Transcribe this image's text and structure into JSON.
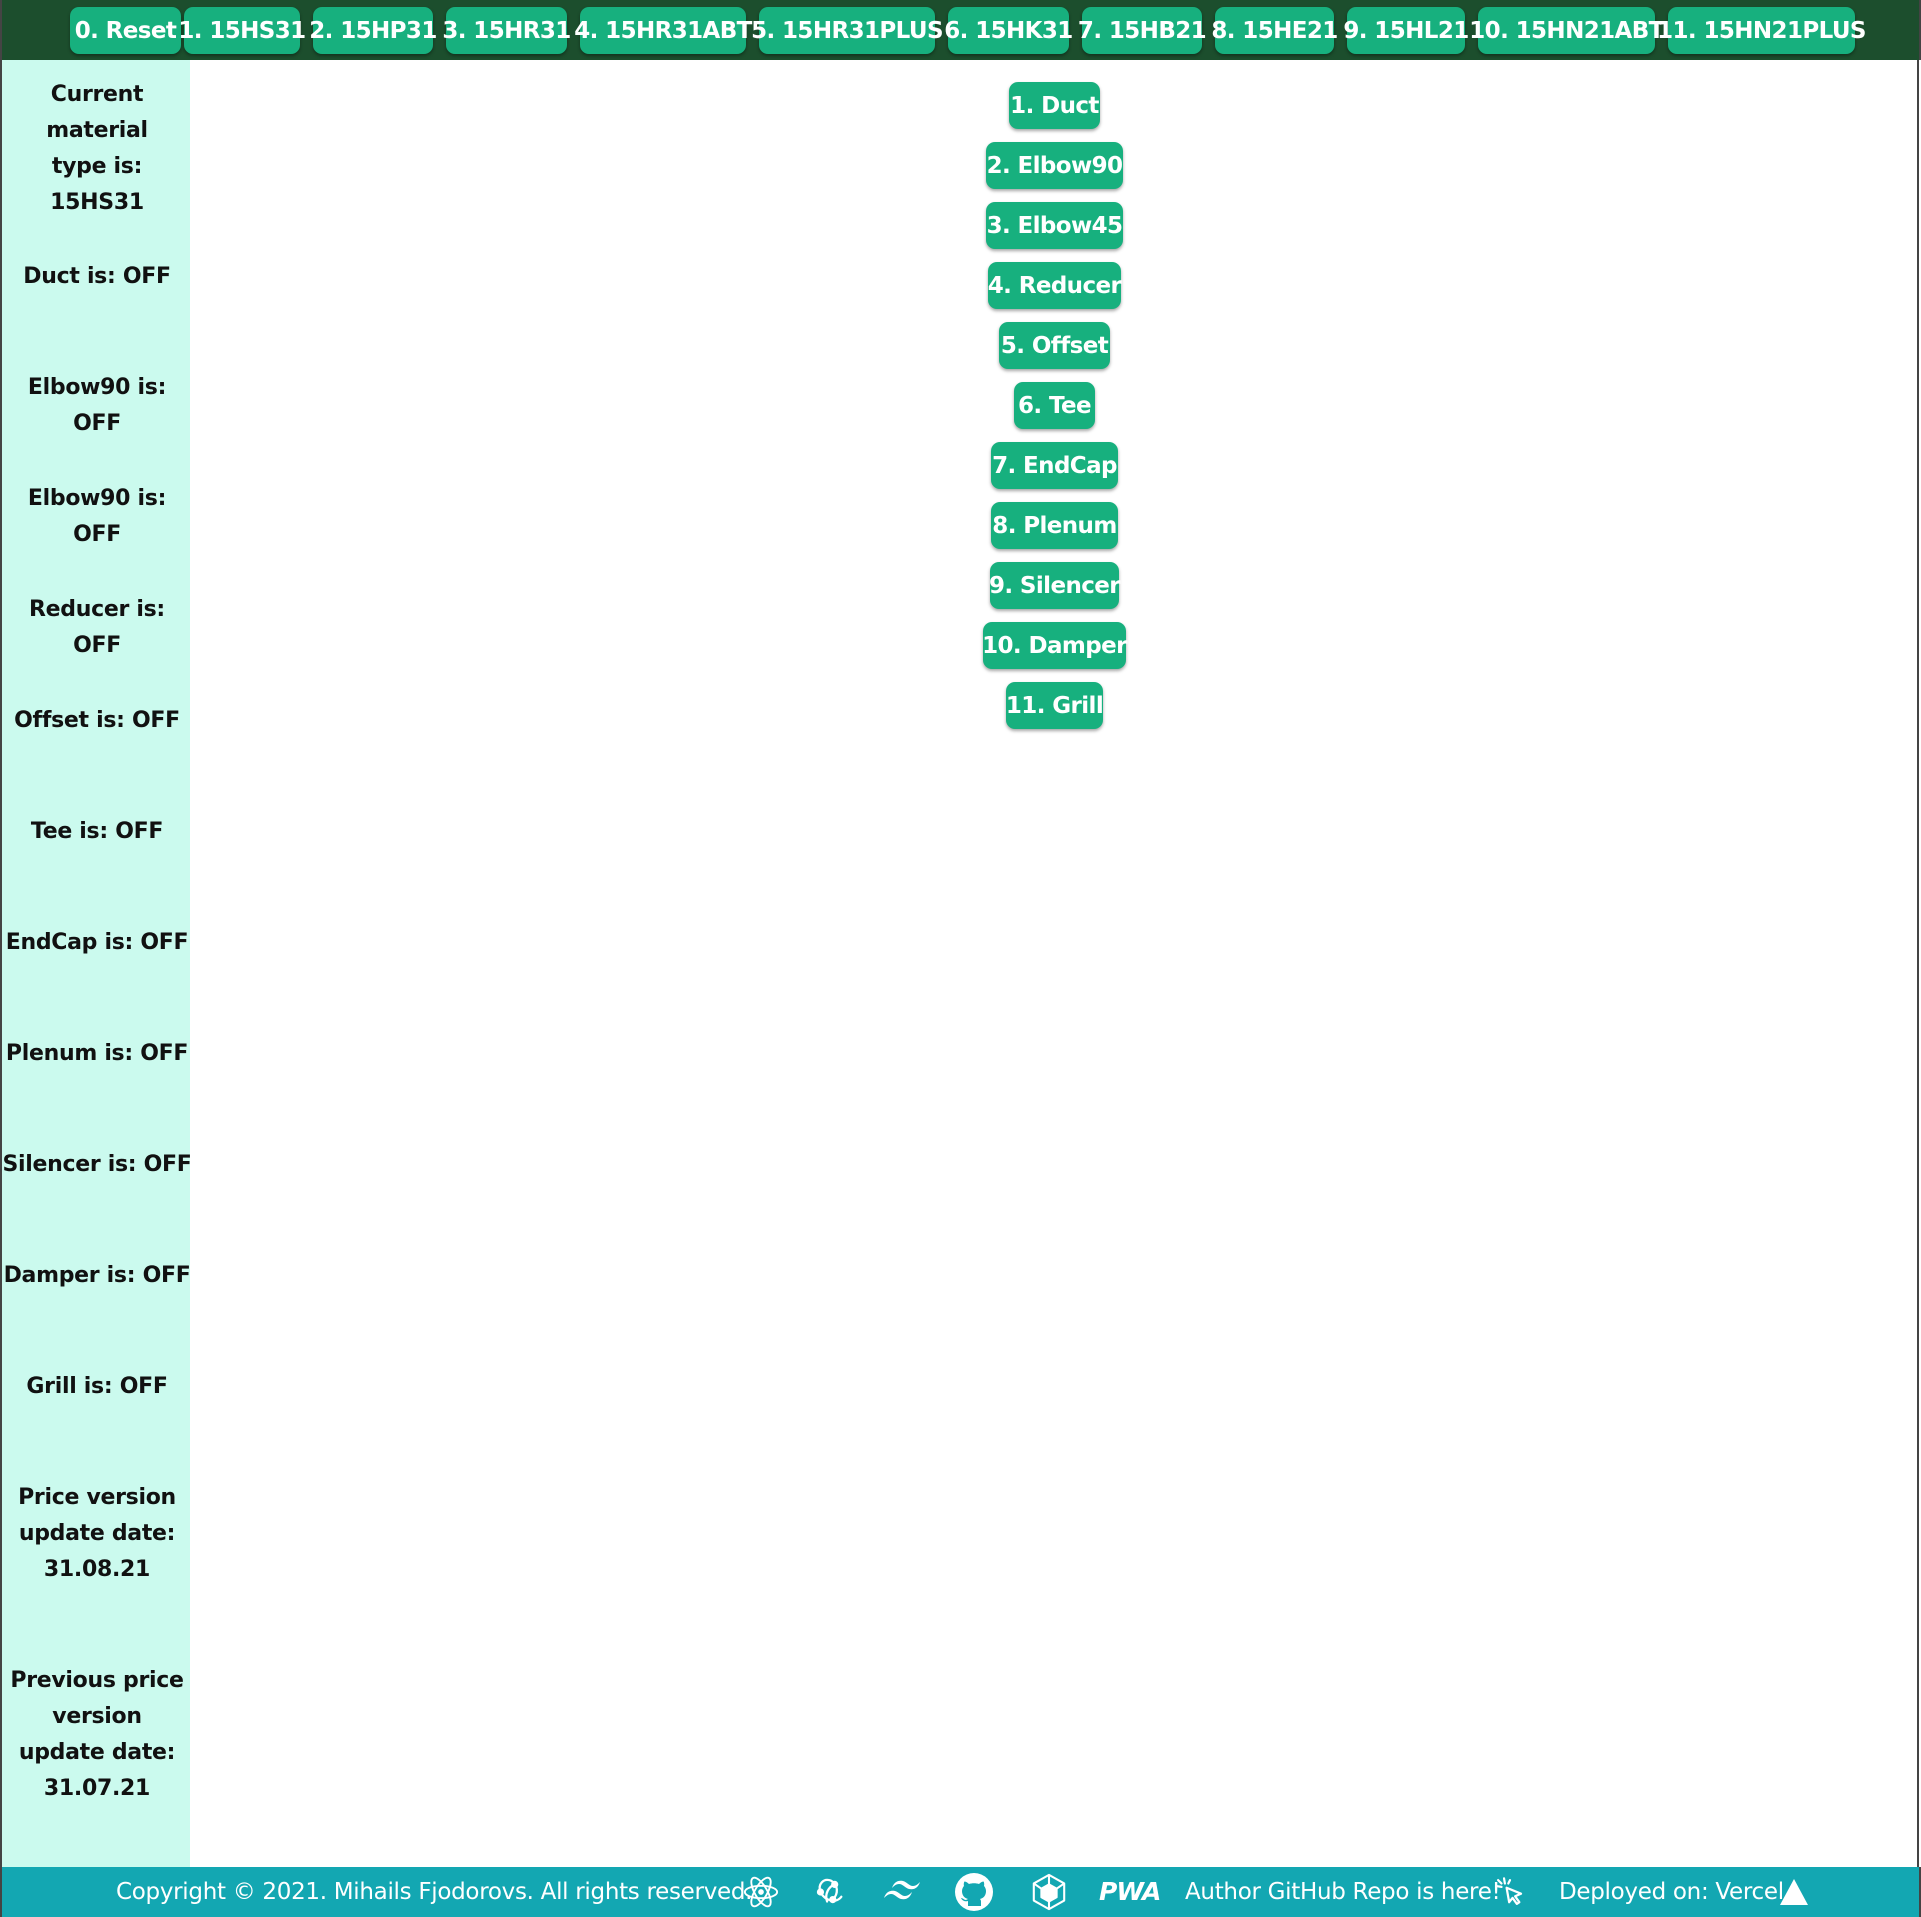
{
  "nav": {
    "items": [
      {
        "label": "0. Reset"
      },
      {
        "label": "1. 15HS31"
      },
      {
        "label": "2. 15HP31"
      },
      {
        "label": "3. 15HR31"
      },
      {
        "label": "4. 15HR31ABT"
      },
      {
        "label": "5. 15HR31PLUS"
      },
      {
        "label": "6. 15HK31"
      },
      {
        "label": "7. 15HB21"
      },
      {
        "label": "8. 15HE21"
      },
      {
        "label": "9. 15HL21"
      },
      {
        "label": "10. 15HN21ABT"
      },
      {
        "label": "11. 15HN21PLUS"
      }
    ]
  },
  "sidebar": {
    "current_material": "Current material type is: 15HS31",
    "statuses": [
      {
        "text": "Duct is: OFF"
      },
      {
        "text": "Elbow90 is: OFF"
      },
      {
        "text": "Elbow90 is: OFF"
      },
      {
        "text": "Reducer is: OFF"
      },
      {
        "text": "Offset is: OFF"
      },
      {
        "text": "Tee is: OFF"
      },
      {
        "text": "EndCap is: OFF"
      },
      {
        "text": "Plenum is: OFF"
      },
      {
        "text": "Silencer is: OFF"
      },
      {
        "text": "Damper is: OFF"
      },
      {
        "text": "Grill is: OFF"
      }
    ],
    "price_update": "Price version update date: 31.08.21",
    "prev_price_update": "Previous price version update date: 31.07.21"
  },
  "parts": {
    "items": [
      {
        "label": "1. Duct"
      },
      {
        "label": "2. Elbow90"
      },
      {
        "label": "3. Elbow45"
      },
      {
        "label": "4. Reducer"
      },
      {
        "label": "5. Offset"
      },
      {
        "label": "6. Tee"
      },
      {
        "label": "7. EndCap"
      },
      {
        "label": "8. Plenum"
      },
      {
        "label": "9. Silencer"
      },
      {
        "label": "10. Damper"
      },
      {
        "label": "11. Grill"
      }
    ]
  },
  "footer": {
    "copyright": "Copyright © 2021. Mihails Fjodorovs. All rights reserved.",
    "pwa_label": "PWA",
    "repo_link": "Author GitHub Repo is here!",
    "deployed": "Deployed on: Vercel",
    "icons": [
      "react-icon",
      "redux-icon",
      "tailwind-icon",
      "github-icon",
      "webpack-icon",
      "pwa-icon",
      "cursor-click-icon",
      "vercel-triangle-icon"
    ]
  },
  "colors": {
    "nav_bg": "#1c4e2d",
    "button": "#17b07e",
    "sidebar_bg": "#cbfaee",
    "footer_bg": "#13a7b2"
  }
}
